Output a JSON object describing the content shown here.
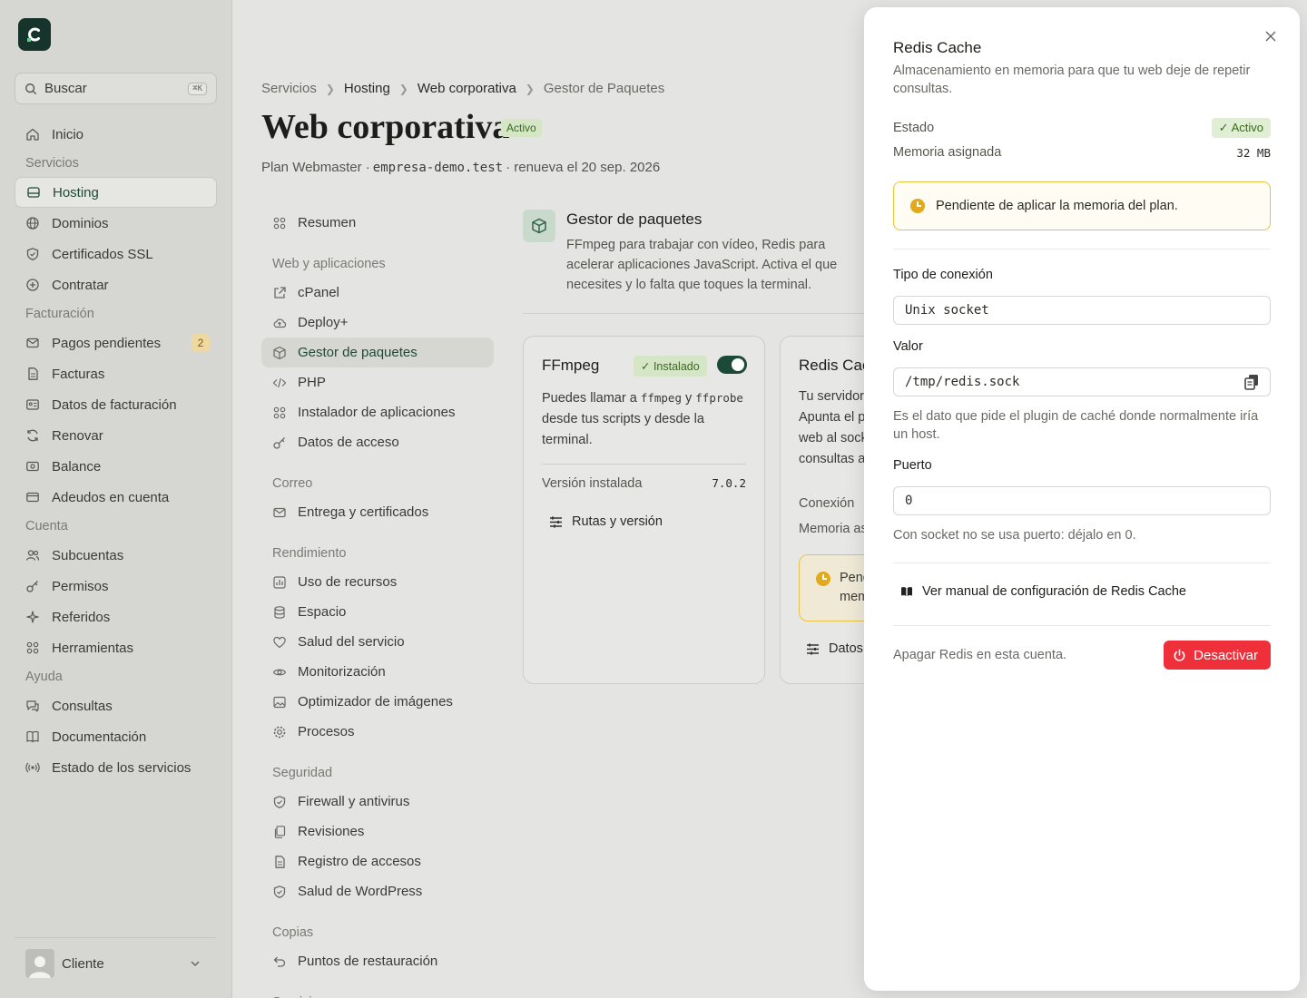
{
  "sidebar": {
    "search_label": "Buscar",
    "search_shortcut": "⌘K",
    "items": [
      {
        "type": "item",
        "label": "Inicio",
        "icon": "home-icon"
      },
      {
        "type": "head",
        "label": "Servicios"
      },
      {
        "type": "item",
        "label": "Hosting",
        "icon": "server-icon",
        "active": true
      },
      {
        "type": "item",
        "label": "Dominios",
        "icon": "globe-icon"
      },
      {
        "type": "item",
        "label": "Certificados SSL",
        "icon": "shield-icon"
      },
      {
        "type": "item",
        "label": "Contratar",
        "icon": "plus-circle-icon"
      },
      {
        "type": "head",
        "label": "Facturación"
      },
      {
        "type": "item",
        "label": "Pagos pendientes",
        "icon": "mail-icon",
        "badge": "2"
      },
      {
        "type": "item",
        "label": "Facturas",
        "icon": "file-icon"
      },
      {
        "type": "item",
        "label": "Datos de facturación",
        "icon": "id-card-icon"
      },
      {
        "type": "item",
        "label": "Renovar",
        "icon": "refresh-icon"
      },
      {
        "type": "item",
        "label": "Balance",
        "icon": "banknote-icon"
      },
      {
        "type": "item",
        "label": "Adeudos en cuenta",
        "icon": "card-icon"
      },
      {
        "type": "head",
        "label": "Cuenta"
      },
      {
        "type": "item",
        "label": "Subcuentas",
        "icon": "users-icon"
      },
      {
        "type": "item",
        "label": "Permisos",
        "icon": "key-icon"
      },
      {
        "type": "item",
        "label": "Referidos",
        "icon": "sparkle-icon"
      },
      {
        "type": "item",
        "label": "Herramientas",
        "icon": "grid-icon"
      },
      {
        "type": "head",
        "label": "Ayuda"
      },
      {
        "type": "item",
        "label": "Consultas",
        "icon": "chat-icon"
      },
      {
        "type": "item",
        "label": "Documentación",
        "icon": "book-icon"
      },
      {
        "type": "item",
        "label": "Estado de los servicios",
        "icon": "broadcast-icon"
      }
    ],
    "user_name": "Cliente"
  },
  "breadcrumb": [
    "Servicios",
    "Hosting",
    "Web corporativa",
    "Gestor de Paquetes"
  ],
  "page": {
    "title": "Web corporativa",
    "status": "Activo",
    "plan_prefix": "Plan Webmaster ·",
    "domain": "empresa-demo.test",
    "renew": "· renueva el 20 sep. 2026"
  },
  "subnav": [
    {
      "type": "item",
      "label": "Resumen",
      "icon": "grid-icon"
    },
    {
      "type": "head",
      "label": "Web y aplicaciones"
    },
    {
      "type": "item",
      "label": "cPanel",
      "icon": "external-link-icon"
    },
    {
      "type": "item",
      "label": "Deploy+",
      "icon": "cloud-upload-icon"
    },
    {
      "type": "item",
      "label": "Gestor de paquetes",
      "icon": "package-icon",
      "active": true
    },
    {
      "type": "item",
      "label": "PHP",
      "icon": "code-icon"
    },
    {
      "type": "item",
      "label": "Instalador de aplicaciones",
      "icon": "grid-icon"
    },
    {
      "type": "item",
      "label": "Datos de acceso",
      "icon": "key-icon"
    },
    {
      "type": "head",
      "label": "Correo"
    },
    {
      "type": "item",
      "label": "Entrega y certificados",
      "icon": "mail-icon"
    },
    {
      "type": "head",
      "label": "Rendimiento"
    },
    {
      "type": "item",
      "label": "Uso de recursos",
      "icon": "chart-icon"
    },
    {
      "type": "item",
      "label": "Espacio",
      "icon": "database-icon"
    },
    {
      "type": "item",
      "label": "Salud del servicio",
      "icon": "heart-icon"
    },
    {
      "type": "item",
      "label": "Monitorización",
      "icon": "eye-icon"
    },
    {
      "type": "item",
      "label": "Optimizador de imágenes",
      "icon": "image-icon"
    },
    {
      "type": "item",
      "label": "Procesos",
      "icon": "cog-icon"
    },
    {
      "type": "head",
      "label": "Seguridad"
    },
    {
      "type": "item",
      "label": "Firewall y antivirus",
      "icon": "shield-icon"
    },
    {
      "type": "item",
      "label": "Revisiones",
      "icon": "copy-icon"
    },
    {
      "type": "item",
      "label": "Registro de accesos",
      "icon": "file-icon"
    },
    {
      "type": "item",
      "label": "Salud de WordPress",
      "icon": "shield-icon"
    },
    {
      "type": "head",
      "label": "Copias"
    },
    {
      "type": "item",
      "label": "Puntos de restauración",
      "icon": "undo-icon"
    },
    {
      "type": "head",
      "label": "Servicios"
    }
  ],
  "packages": {
    "title": "Gestor de paquetes",
    "desc": "FFmpeg para trabajar con vídeo, Redis para acelerar aplicaciones JavaScript. Activa el que necesites y lo falta que toques la terminal."
  },
  "ffmpeg": {
    "title": "FFmpeg",
    "badge": "✓ Instalado",
    "desc_prefix": "Puedes llamar a",
    "cmd1": "ffmpeg",
    "desc_and": "y",
    "cmd2": "ffprobe",
    "desc_suffix": "desde tus scripts y desde la terminal.",
    "version_label": "Versión instalada",
    "version": "7.0.2",
    "link": "Rutas y versión"
  },
  "redis_card": {
    "title": "Redis Cac",
    "lines": [
      "Tu servidor",
      "Apunta el p",
      "web al sock",
      "consultas a"
    ],
    "conn": "Conexión",
    "mem": "Memoria as",
    "warn1": "Pend",
    "warn2": "mem",
    "link": "Datos"
  },
  "drawer": {
    "title": "Redis Cache",
    "desc": "Almacenamiento en memoria para que tu web deje de repetir consultas.",
    "state_label": "Estado",
    "state_value": "✓ Activo",
    "memory_label": "Memoria asignada",
    "memory_value": "32 MB",
    "warning": "Pendiente de aplicar la memoria del plan.",
    "conn_label": "Tipo de conexión",
    "conn_value": "Unix socket",
    "value_label": "Valor",
    "value_value": "/tmp/redis.sock",
    "value_help": "Es el dato que pide el plugin de caché donde normalmente iría un host.",
    "port_label": "Puerto",
    "port_value": "0",
    "port_help": "Con socket no se usa puerto: déjalo en 0.",
    "manual_link": "Ver manual de configuración de Redis Cache",
    "footer_text": "Apagar Redis en esta cuenta.",
    "deactivate": "Desactivar"
  },
  "colors": {
    "accent": "#1c4a38",
    "danger": "#ef2f3a",
    "warning": "#e2a91a",
    "success_bg": "#d5e6c6"
  }
}
